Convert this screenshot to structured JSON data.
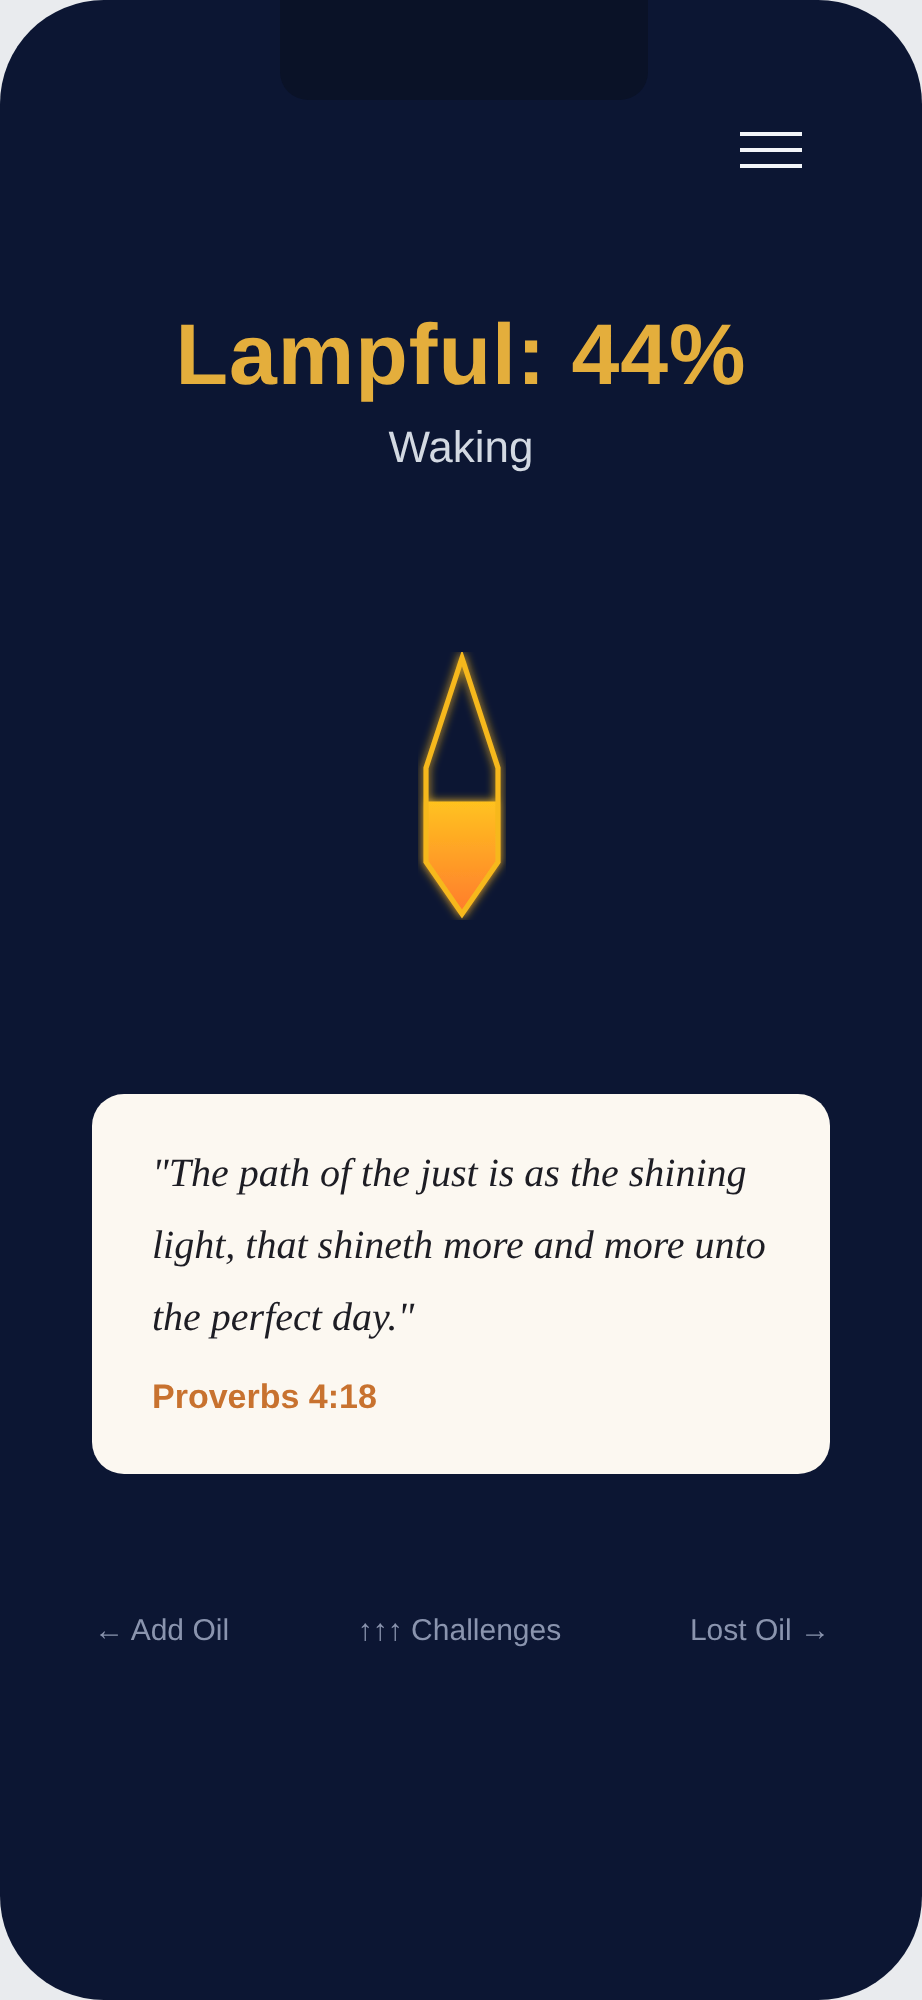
{
  "header": {
    "title": "Lampful: 44%",
    "subtitle": "Waking"
  },
  "lamp": {
    "level": 0.44
  },
  "verse": {
    "text": "\"The path of the just is as the shining light, that shineth more and more unto the perfect day.\"",
    "reference": "Proverbs 4:18"
  },
  "nav": [
    {
      "label": "← Add Oil"
    },
    {
      "label": "↑↑↑ Challenges"
    },
    {
      "label": "Lost Oil →"
    }
  ]
}
